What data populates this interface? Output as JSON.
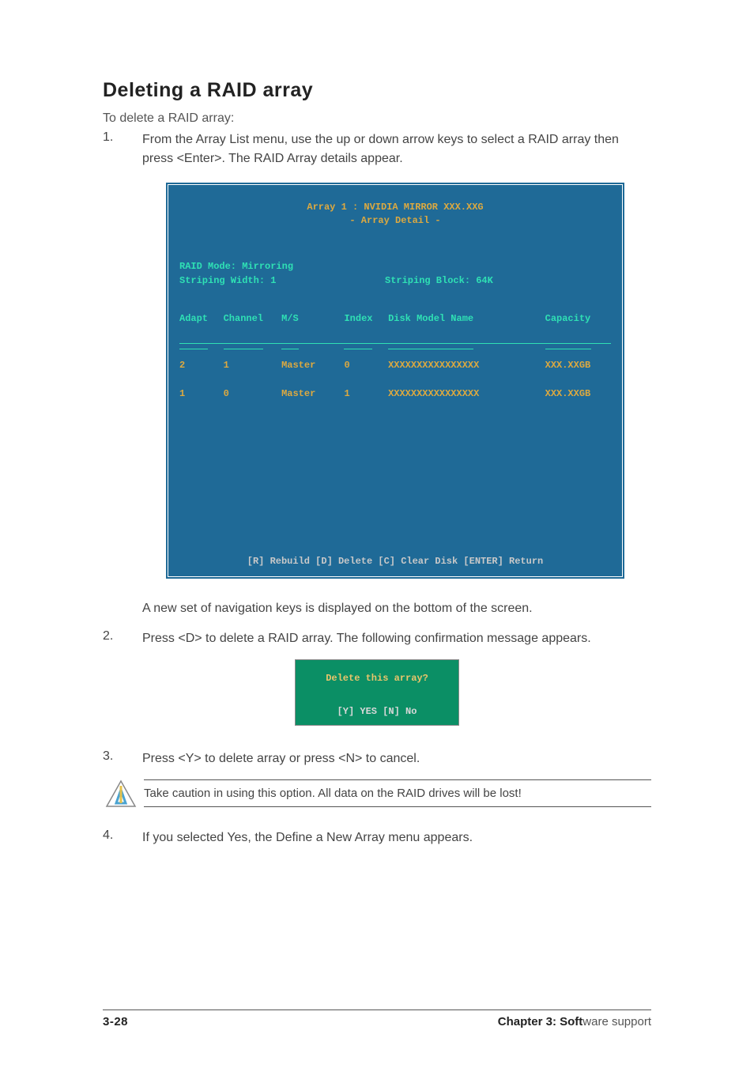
{
  "heading": "Deleting a RAID array",
  "intro": "To delete a RAID array:",
  "steps": {
    "s1_num": "1.",
    "s1_txt": "From the Array List menu, use the up or down arrow keys to select a RAID array then press <Enter>. The RAID Array details appear.",
    "s1b_txt": "A new set of  navigation keys is displayed on the bottom of the screen.",
    "s2_num": "2.",
    "s2_txt": "Press <D> to delete a RAID array. The following confirmation message appears.",
    "s3_num": "3.",
    "s3_txt": "Press <Y> to delete array or press <N> to cancel.",
    "s4_num": "4.",
    "s4_txt": "If you selected Yes, the Define a New Array menu appears."
  },
  "terminal": {
    "title_line1": "Array 1 : NVIDIA MIRROR  XXX.XXG",
    "title_line2": "- Array Detail -",
    "mode": "RAID Mode: Mirroring",
    "sw": "Striping Width: 1",
    "sb": "Striping Block: 64K",
    "cols": {
      "adapt": "Adapt",
      "channel": "Channel",
      "ms": "M/S",
      "index": "Index",
      "disk": "Disk Model Name",
      "cap": "Capacity"
    },
    "rows": [
      {
        "adapt": "2",
        "channel": "1",
        "ms": "Master",
        "index": "0",
        "disk": "XXXXXXXXXXXXXXXX",
        "cap": "XXX.XXGB"
      },
      {
        "adapt": "1",
        "channel": "0",
        "ms": "Master",
        "index": "1",
        "disk": "XXXXXXXXXXXXXXXX",
        "cap": "XXX.XXGB"
      }
    ],
    "footer": "[R] Rebuild  [D] Delete  [C] Clear Disk  [ENTER] Return"
  },
  "dialog": {
    "question": "Delete this array?",
    "options": "[Y] YES   [N] No"
  },
  "caution": "Take caution in using this option. All data on the RAID drives will be lost!",
  "footer": {
    "left": "3-28",
    "right_bold": "Chapter 3: Soft",
    "right_light": "ware support"
  }
}
